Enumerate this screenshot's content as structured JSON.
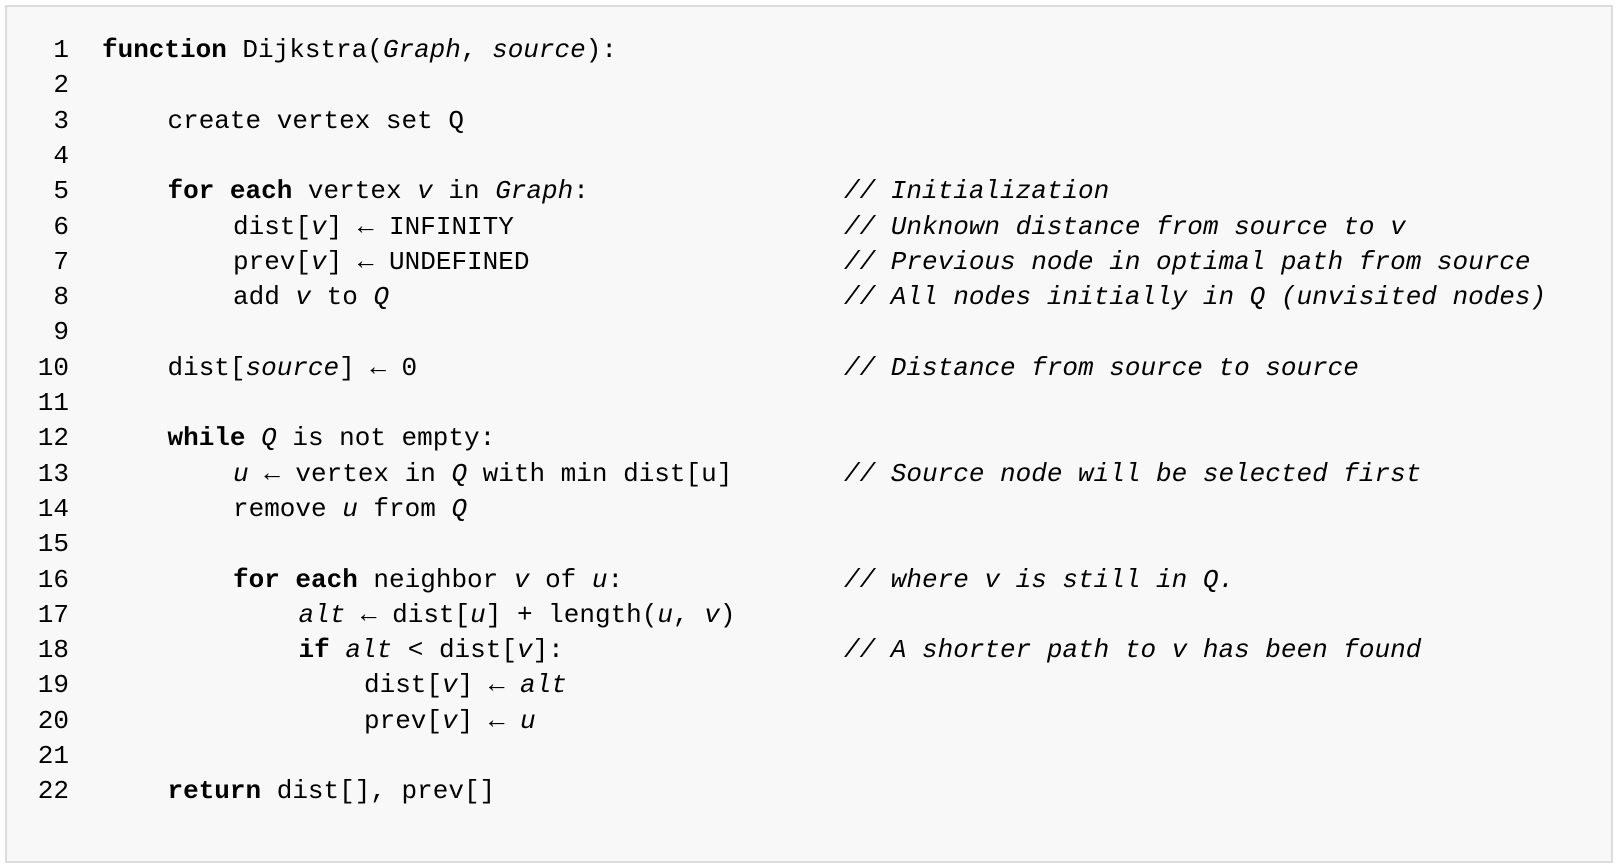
{
  "lines": [
    {
      "n": "1",
      "indent": 0,
      "segs": [
        {
          "t": "function",
          "s": "kw"
        },
        {
          "t": " Dijkstra("
        },
        {
          "t": "Graph",
          "s": "it"
        },
        {
          "t": ", "
        },
        {
          "t": "source",
          "s": "it"
        },
        {
          "t": "):"
        }
      ],
      "comment": ""
    },
    {
      "n": "2",
      "indent": 0,
      "segs": [],
      "comment": ""
    },
    {
      "n": "3",
      "indent": 1,
      "segs": [
        {
          "t": "create vertex set Q"
        }
      ],
      "comment": ""
    },
    {
      "n": "4",
      "indent": 0,
      "segs": [],
      "comment": ""
    },
    {
      "n": "5",
      "indent": 1,
      "segs": [
        {
          "t": "for each",
          "s": "kw"
        },
        {
          "t": " vertex "
        },
        {
          "t": "v",
          "s": "it"
        },
        {
          "t": " in "
        },
        {
          "t": "Graph",
          "s": "it"
        },
        {
          "t": ":"
        }
      ],
      "comment": "// Initialization"
    },
    {
      "n": "6",
      "indent": 2,
      "segs": [
        {
          "t": "dist["
        },
        {
          "t": "v",
          "s": "it"
        },
        {
          "t": "] ← INFINITY"
        }
      ],
      "comment": "// Unknown distance from source to v"
    },
    {
      "n": "7",
      "indent": 2,
      "segs": [
        {
          "t": "prev["
        },
        {
          "t": "v",
          "s": "it"
        },
        {
          "t": "] ← UNDEFINED"
        }
      ],
      "comment": "// Previous node in optimal path from source"
    },
    {
      "n": "8",
      "indent": 2,
      "segs": [
        {
          "t": "add "
        },
        {
          "t": "v",
          "s": "it"
        },
        {
          "t": " to "
        },
        {
          "t": "Q",
          "s": "it"
        }
      ],
      "comment": "// All nodes initially in Q (unvisited nodes)"
    },
    {
      "n": "9",
      "indent": 0,
      "segs": [],
      "comment": ""
    },
    {
      "n": "10",
      "indent": 1,
      "segs": [
        {
          "t": "dist["
        },
        {
          "t": "source",
          "s": "it"
        },
        {
          "t": "] ← 0"
        }
      ],
      "comment": "// Distance from source to source"
    },
    {
      "n": "11",
      "indent": 0,
      "segs": [],
      "comment": ""
    },
    {
      "n": "12",
      "indent": 1,
      "segs": [
        {
          "t": "while",
          "s": "kw"
        },
        {
          "t": " "
        },
        {
          "t": "Q",
          "s": "it"
        },
        {
          "t": " is not empty:"
        }
      ],
      "comment": ""
    },
    {
      "n": "13",
      "indent": 2,
      "segs": [
        {
          "t": "u",
          "s": "it"
        },
        {
          "t": " ← vertex in "
        },
        {
          "t": "Q",
          "s": "it"
        },
        {
          "t": " with min dist[u]"
        }
      ],
      "comment": "// Source node will be selected first"
    },
    {
      "n": "14",
      "indent": 2,
      "segs": [
        {
          "t": "remove "
        },
        {
          "t": "u",
          "s": "it"
        },
        {
          "t": " from "
        },
        {
          "t": "Q",
          "s": "it"
        }
      ],
      "comment": ""
    },
    {
      "n": "15",
      "indent": 0,
      "segs": [],
      "comment": ""
    },
    {
      "n": "16",
      "indent": 2,
      "segs": [
        {
          "t": "for each",
          "s": "kw"
        },
        {
          "t": " neighbor "
        },
        {
          "t": "v",
          "s": "it"
        },
        {
          "t": " of "
        },
        {
          "t": "u",
          "s": "it"
        },
        {
          "t": ":"
        }
      ],
      "comment": "// where v is still in Q."
    },
    {
      "n": "17",
      "indent": 3,
      "segs": [
        {
          "t": "alt",
          "s": "it"
        },
        {
          "t": " ← dist["
        },
        {
          "t": "u",
          "s": "it"
        },
        {
          "t": "] + length("
        },
        {
          "t": "u",
          "s": "it"
        },
        {
          "t": ", "
        },
        {
          "t": "v",
          "s": "it"
        },
        {
          "t": ")"
        }
      ],
      "comment": ""
    },
    {
      "n": "18",
      "indent": 3,
      "segs": [
        {
          "t": "if",
          "s": "kw"
        },
        {
          "t": " "
        },
        {
          "t": "alt",
          "s": "it"
        },
        {
          "t": " < dist["
        },
        {
          "t": "v",
          "s": "it"
        },
        {
          "t": "]:"
        }
      ],
      "comment": "// A shorter path to v has been found"
    },
    {
      "n": "19",
      "indent": 4,
      "segs": [
        {
          "t": "dist["
        },
        {
          "t": "v",
          "s": "it"
        },
        {
          "t": "] ← "
        },
        {
          "t": "alt",
          "s": "it"
        }
      ],
      "comment": ""
    },
    {
      "n": "20",
      "indent": 4,
      "segs": [
        {
          "t": "prev["
        },
        {
          "t": "v",
          "s": "it"
        },
        {
          "t": "] ← "
        },
        {
          "t": "u",
          "s": "it"
        }
      ],
      "comment": ""
    },
    {
      "n": "21",
      "indent": 0,
      "segs": [],
      "comment": ""
    },
    {
      "n": "22",
      "indent": 1,
      "segs": [
        {
          "t": "return",
          "s": "kw"
        },
        {
          "t": " dist[], prev[]"
        }
      ],
      "comment": ""
    }
  ]
}
